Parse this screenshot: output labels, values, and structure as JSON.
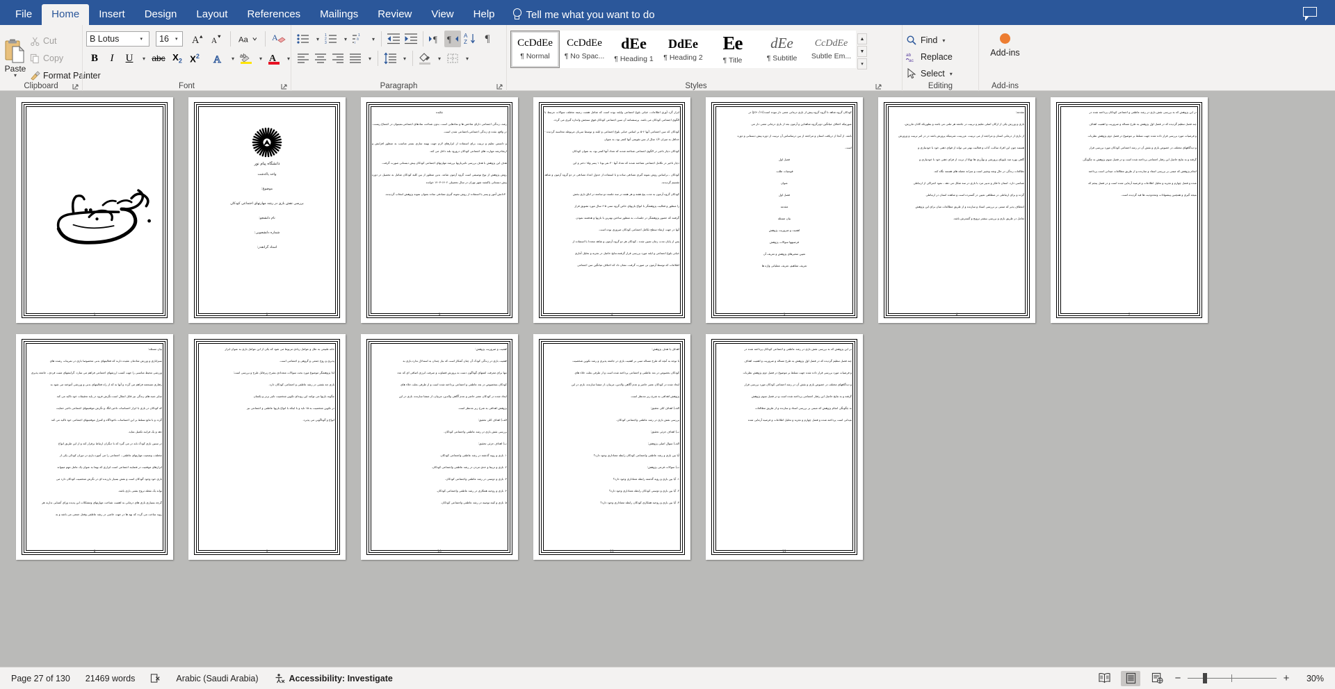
{
  "app": {
    "comment_icon": "comment-icon"
  },
  "tabs": [
    {
      "label": "File",
      "active": false
    },
    {
      "label": "Home",
      "active": true
    },
    {
      "label": "Insert",
      "active": false
    },
    {
      "label": "Design",
      "active": false
    },
    {
      "label": "Layout",
      "active": false
    },
    {
      "label": "References",
      "active": false
    },
    {
      "label": "Mailings",
      "active": false
    },
    {
      "label": "Review",
      "active": false
    },
    {
      "label": "View",
      "active": false
    },
    {
      "label": "Help",
      "active": false
    }
  ],
  "tellme": {
    "label": "Tell me what you want to do",
    "icon": "lightbulb-icon"
  },
  "ribbon": {
    "clipboard": {
      "group_label": "Clipboard",
      "paste": "Paste",
      "cut": "Cut",
      "copy": "Copy",
      "format_painter": "Format Painter"
    },
    "font": {
      "group_label": "Font",
      "font_name": "B Lotus",
      "font_size": "16",
      "grow_font": "Increase Font Size",
      "shrink_font": "Decrease Font Size",
      "change_case": "Aa",
      "clear_formatting": "Clear All Formatting",
      "bold": "B",
      "italic": "I",
      "underline": "U",
      "strikethrough": "abc",
      "subscript": "X2",
      "superscript": "X2",
      "text_effects": "A",
      "highlight": "ab",
      "font_color": "A"
    },
    "paragraph": {
      "group_label": "Paragraph",
      "bullets": "Bullets",
      "numbering": "Numbering",
      "multilevel": "Multilevel List",
      "decrease_indent": "Decrease Indent",
      "increase_indent": "Increase Indent",
      "ltr": "Left-to-Right Text Direction",
      "rtl": "Right-to-Left Text Direction",
      "sort": "Sort",
      "show_marks": "Show/Hide ¶",
      "align_left": "Align Left",
      "align_center": "Center",
      "align_right": "Align Right",
      "justify": "Justify",
      "line_spacing": "Line and Paragraph Spacing",
      "shading": "Shading",
      "borders": "Borders"
    },
    "styles": {
      "group_label": "Styles",
      "items": [
        {
          "preview": "CcDdEe",
          "name": "¶ Normal",
          "style": "normal",
          "active": true
        },
        {
          "preview": "CcDdEe",
          "name": "¶ No Spac...",
          "style": "nospace",
          "active": false
        },
        {
          "preview": "dEe",
          "name": "¶ Heading 1",
          "style": "h1",
          "active": false
        },
        {
          "preview": "DdEe",
          "name": "¶ Heading 2",
          "style": "h2",
          "active": false
        },
        {
          "preview": "Ee",
          "name": "¶ Title",
          "style": "title",
          "active": false
        },
        {
          "preview": "dEe",
          "name": "¶ Subtitle",
          "style": "subtitle",
          "active": false
        },
        {
          "preview": "CcDdEe",
          "name": "Subtle Em...",
          "style": "subtle",
          "active": false
        }
      ]
    },
    "editing": {
      "group_label": "Editing",
      "find": "Find",
      "replace": "Replace",
      "select": "Select"
    },
    "addins": {
      "group_label": "Add-ins",
      "label": "Add-ins"
    }
  },
  "status": {
    "page": "Page 27 of 130",
    "words": "21469 words",
    "proofing_icon": "proofing-errors-icon",
    "language": "Arabic (Saudi Arabia)",
    "accessibility": "Accessibility: Investigate",
    "view_read": "Read Mode",
    "view_print": "Print Layout",
    "view_web": "Web Layout",
    "zoom_out": "−",
    "zoom_in": "+",
    "zoom_level": "30%"
  },
  "document": {
    "pages": [
      {
        "num": "1",
        "kind": "bismillah",
        "lines": []
      },
      {
        "num": "2",
        "kind": "title",
        "logo_caption": "دانشگاه پیام نور",
        "lines": [
          {
            "t": "واحد پاکدشت",
            "a": "c"
          },
          {
            "t": "موضوع:",
            "a": "c"
          },
          {
            "t": "بررسی نقش بازی در رشد مهارتهای اجتماعی کودکان",
            "a": "c"
          },
          {
            "t": "نام دانشجو:",
            "a": "c"
          },
          {
            "t": "شماره دانشجویی:",
            "a": "c"
          },
          {
            "t": "استاد گرانقدر:",
            "a": "c"
          }
        ]
      },
      {
        "num": "3",
        "kind": "text",
        "lines": [
          {
            "t": "چکیده",
            "a": "c"
          },
          {
            "t": "رشد، زندگی اجتماعی دارای شاخص ها و نمادهایی است. بدون شناخت نمادهای اجتماعی،نمیتوان در اجتماع زیست. در واقع، نقده ی زندگی اجتماعی،اجتماعی شدن است.",
            "a": "j"
          },
          {
            "t": "و دانستن تعلیم و تربیت برای استفاده از ابزارهای لازم جهت بهینه سازی بستر مناسب به منظور افزایش و ارتقاءرشد مهارت های اجتماعی کودکان درورود بلند داخل می کند.",
            "a": "j"
          },
          {
            "t": "هدف این پژوهش با هدف بررسی تاثیربازیها بررشد مهارتهای اجتماعی کودکان پیش دبستانی صورت گرفت.",
            "a": "j"
          },
          {
            "t": "روش پژوهش از نوع توصیفی است گروه آزمون شامد. بدین منظور از بین کلیه کودکان شامل به تحصیل در دوره پیش دبستانی یاکشند شهر تهران در سال تحصیلی ۱۴۰۲-۱۴۰۳ خوانده",
            "a": "j"
          },
          {
            "t": "۳۰دانش آموز و پسر با استفاده از روش نمونه گیری تصادفی ساده بعنوان نمونه پژوهش انتخاب گردیدند.",
            "a": "j"
          }
        ]
      },
      {
        "num": "4",
        "kind": "text",
        "lines": [
          {
            "t": "ابزار گرد آوری اطلاعات، خیانی بلوغ اجتماعی وایلند بوده است که شامل هشت زمینه مختلف سوالات مرتبط با الگوی اجتماعی کودکان می باشد. پرسشنامه آن سین اجتماعی کودکان فوق سنجش واندازه گیری می گردد.",
            "a": "j"
          },
          {
            "t": "کودکان که سن اجتماعی آنها ۶-۵ بر اساس خیانی بلوغ اجتماعی و ایلند و توسط سریان مربوطه محاسبه گردیده - حداقل به میزان ۱/۲ سال از سن تقویمی آنها کمتر بود، به عنوان",
            "a": "j"
          },
          {
            "t": "کودکان دچار تاخیر در الگوی اجتماعی شناخته شدند که تعداد آنها کمتر بود، به عنوان کودکان",
            "a": "j"
          },
          {
            "t": "دچار تاخیر در تکامل اجتماعی شناخته شدند که تعداد آنها ۳۰ نفر بودا ۱ پسر و۱۵ دختر و این",
            "a": "j"
          },
          {
            "t": "کودکان ، براساس روش نمونه گیری تصادفی ساده و با استفاده از جدول اعداد تصادفی در دو گروه آزمون و شاهد تقسیم گردیدند.",
            "a": "j"
          },
          {
            "t": "کودکان گروه آزمون به مدت پنج هفته و هر هفته در سه جلسه دو ساعته در اتاق بازی بخش",
            "a": "j"
          },
          {
            "t": "را منظور و فعالیت پژوهشگر با انواع بازیهای خاص گروه سنی ۵-۶ سال مورد تشویق قرار",
            "a": "j"
          },
          {
            "t": "گرفتند که حضور پژوهشگر در جلسات، به منظور ساختن بهترین با بازیها و هدفمند نمودن",
            "a": "j"
          },
          {
            "t": "آنها در جهت ارتقاء سطح تکامل اجتماعی کودکان ضروری بوده است.",
            "a": "j"
          },
          {
            "t": "پس از پایان مدت زمان تعیین شده ، کودکان هر دو گروه آزمون و شاهد مجددا با استفاده از",
            "a": "j"
          },
          {
            "t": "خیانی بلوغ اجتماعی و ایلند مورد بررسی قرار گرفتند،نتایج حاصل در تجزیه و تحلیل آماری",
            "a": "j"
          },
          {
            "t": "اطلاعات که توسط آزمون تی صورت گرفت، نشان داد که اختلاف میانگین سن اجتماعی",
            "a": "j"
          }
        ]
      },
      {
        "num": "5",
        "kind": "text",
        "lines": [
          {
            "t": "کودکان گروه شاهد تا گروه   گروه پیش از بازی درمانی معنی دار نبوده است(۰/۱۷<p) در",
            "a": "j"
          },
          {
            "t": "صورتیکه اختلاف میانگین دوبرگروه شاهداین و آزمون بعد از بازی درمانی معنی دار می",
            "a": "j"
          },
          {
            "t": "باشد. از آنجا از دریافت استان و مراجعه از بین درساساس آن تربیت از دوره پیش دبستانی و دوره",
            "a": "j"
          },
          {
            "t": "است.",
            "a": "j"
          },
          {
            "t": "فصل اول",
            "a": "c"
          },
          {
            "t": "قوسیات طلب.",
            "a": "c"
          },
          {
            "t": "عنوان",
            "a": "c"
          },
          {
            "t": "فصل اول",
            "a": "c"
          },
          {
            "t": "مقدمه",
            "a": "c"
          },
          {
            "t": "بیان مسئله",
            "a": "c"
          },
          {
            "t": "اهمیت و ضروریت پژوهش",
            "a": "c"
          },
          {
            "t": "فرضیهها سوالات پژوهش",
            "a": "c"
          },
          {
            "t": "تعیین متغیرهای پژوهش و تعریف آن",
            "a": "c"
          },
          {
            "t": "تعریف مفاهیم، تعریف عملیاتی واژه ها",
            "a": "c"
          }
        ]
      },
      {
        "num": "6",
        "kind": "text",
        "lines": [
          {
            "t": "مقدمه:",
            "a": "r"
          },
          {
            "t": "بازی و ورزش یکی از ارکان اصلی تعلیم و تربیت در جامعه هر ملتی می باشد و بطوریکه کانان مارزش،",
            "a": "j"
          },
          {
            "t": "از بازی از درمانی استان و مراجعه از می تربیت، عزربیت، شربتیکه پرورش باشد در در امر تربیت و ورورش",
            "a": "j"
          },
          {
            "t": "هستند چون این افراد سالب، آداب و فعالیت بهتر می تواند از قوای ذهنی خود با خودنیازی و",
            "a": "j"
          },
          {
            "t": "گاهی بهره مند باپویای پرورشی و بهآرزی ها تهانا از تربت از فرای ذهنی خود با خودنیازی و",
            "a": "j"
          },
          {
            "t": "نطالعات زندگی در حال وشد وتغییر است و سرانه عضله های هستند نگاه کند.",
            "a": "j"
          },
          {
            "t": "شناسی دارد. استان تا فکر و تدبیر مرد با بازی در سه شکل می دهد ، نمود اجتراکی از ارتباطی",
            "a": "j"
          },
          {
            "t": "گرده و برای ارتباطی در منظاهی تعیین در گسترده است و شاهده استان در ارتباطی",
            "a": "j"
          },
          {
            "t": "انعطاف پذیر که مبتنی بر بررسی استاد و سازنده و از طریق مطالعات میان برای این پژوهش",
            "a": "j"
          },
          {
            "t": "تعامل در طریق بازی و بررسی بیشتر ترویج و گسترش باشد.",
            "a": "j"
          }
        ]
      },
      {
        "num": "7",
        "kind": "text",
        "lines": [
          {
            "t": "در این پژوهش که به بررسی نقش بازی در رشد عاطفی و اجتماعی کودکان پرداخته شده در",
            "a": "j"
          },
          {
            "t": "چند فصل تنظیم گردیده که در فصل اول پژوهش به طرح مساله و ضروریت و اهمیت اهداف",
            "a": "j"
          },
          {
            "t": "و فرضیات مورد بررسی قرار داده شده جهت تسلط بر موضوع در فصل دوم پژوهش نظریات",
            "a": "j"
          },
          {
            "t": "و دیدگاههای مختلف در خصوص بازی و نقش آن در رشد اجتماعی کودکان مورد بررسی قرار",
            "a": "j"
          },
          {
            "t": "گرفته و به نتایج حاصل این رفتار اجتماعی پرداخته شده است و در فصل سوم پژوهش به چگونگی",
            "a": "j"
          },
          {
            "t": "انجام پژوهش که مبتنی بر بررسی استاد و سازنده و از طریق مطالعات میدانی است پرداخته",
            "a": "j"
          },
          {
            "t": "شده و فصل چهارم و تجزیه و تحلیل اطلاعات و فرضیه آزمایی شده است و در فصل پنجم که",
            "a": "j"
          },
          {
            "t": "نتیجه گیری و همچنین پیشنهادات ومحدودیت ها قید گردیده است.",
            "a": "j"
          }
        ]
      },
      {
        "num": "8",
        "kind": "text",
        "lines": [
          {
            "t": "بیان مسئله:",
            "a": "r"
          },
          {
            "t": "سبزابازی و ورزش شادمان عقیده دارند که فعالیتهای بدنی مخصوصا بازی در تمرینات رشده های",
            "a": "j"
          },
          {
            "t": "ورزشی محیط مناسبی را جهت کسب ارزشهای اجتماعی فراهم می سازد. گرایشهای مثبت فردی ، جامعه پذیری",
            "a": "j"
          },
          {
            "t": "رفتاری مسجمه فراهم می گردد و آنها به که از راه فعالیتهای بدنی و ورزشی آموخته می شود به",
            "a": "j"
          },
          {
            "t": "سایر جنبه های زندگی نیز قابل انتقال است.نگرش فرود در پایه تحقیقات خود تاکید می کند",
            "a": "j"
          },
          {
            "t": "که کودکان در بازی با ابزار احساسات تاخیر،انگا، و نگرش موقعیتهای اجتماعی تاخیر حمایت",
            "a": "j"
          },
          {
            "t": "گردد و با مانع تسلط بر این احساسات ناخوداگاه و کنترل موقعیتهای اجتماعی خود تاکید می کند",
            "a": "j"
          },
          {
            "t": "دهد و یک فرایند تکمیل نماید.",
            "a": "j"
          },
          {
            "t": "در سنین بازی کودک باید در می گیرد که با دیگران ارتباط برقرار کند و از این طریق انواع",
            "a": "j"
          },
          {
            "t": "مختلف، وضعیت مهارتهای عاطفی ، اجتماعی را می آموزد.بازی در دوران کودکی یکی از",
            "a": "j"
          },
          {
            "t": "ابزارهای موقعیت در فضایند اجتماعی است.ابزاری که بهما به عنوان یک عامل مهم میتواند",
            "a": "j"
          },
          {
            "t": "بازی خود وجود گودکان است و نقش بسیار بارزنده ای در نگرش شخصیت کودکان دارد می",
            "a": "j"
          },
          {
            "t": "تواند یک نقطه تروج بشتی بازی باشد.",
            "a": "j"
          },
          {
            "t": "گرچه بسیاری بازی های درمانی به اهمیت شناخت مهارتهای ومشکلات این پدیده ورای آشنایی ندارند هر",
            "a": "j"
          },
          {
            "t": "روید ساخت می گردد که بهه ها در جهت خاصی در رشد عاطفی وفعل جمعی می باشد و به",
            "a": "j"
          }
        ]
      },
      {
        "num": "9",
        "kind": "text",
        "lines": [
          {
            "t": "خانه طبیعی به علل و عوامل زیادی مربوط می شود که یکی از این عوامل بازی به عنوان ابزار",
            "a": "j"
          },
          {
            "t": "پذیری و روج جمعی و گروهی و اجتماعی است.",
            "a": "j"
          },
          {
            "t": "لذا پژوهشگر موضوع مورد بحث سوالات متعدادی بشرح زیرقابل طرح و بررسی است:",
            "a": "j"
          },
          {
            "t": "بازی چه نقشی در رشد عاطفی و اجتماعی کودکان دارد.",
            "a": "r"
          },
          {
            "t": "چگونه بازیها می توانند این روندای تکوین شخصیت تاثیر برتر و یکسان",
            "a": "r"
          },
          {
            "t": "در تکوین شخصیت به ۱۵ ناید و با اینکه با انواع بازیها عاطفی و اجتماعی نیز",
            "a": "r"
          },
          {
            "t": "انواع و گوناگونی می پذیرد.",
            "a": "r"
          }
        ]
      },
      {
        "num": "10",
        "kind": "text",
        "lines": [
          {
            "t": "اهمیت و ضروریت پژوهش:",
            "a": "r"
          },
          {
            "t": "اهمیت بازی در زندگی کودک آن چنان آشکار است که نیاز چندان به استدلال ندارد.بازی به",
            "a": "j"
          },
          {
            "t": "تنها برای معرفت اشتهای گوناگون دست به پرورش قضاوت و صرفت انرژی اضافی ای که عدد",
            "a": "j"
          },
          {
            "t": "کودکان بمخصوص در بعد عاطفی و اجتماعی پرداخته شده است و از طرفی بعلت خلاء های",
            "a": "j"
          },
          {
            "t": "ایجاد شده در کودکان عصر حاضر و عدم آگاهی والدین، مربیان، از منشا سازنده، بازی در این",
            "a": "j"
          },
          {
            "t": "پژوهش اهدافی به شرح زیر مدنظر است.",
            "a": "j"
          },
          {
            "t": "الف) اهداف کلی تحقیق:",
            "a": "r"
          },
          {
            "t": "بررسی نقش بازی در رشد عاطفی واجتماعی کودکان.",
            "a": "r"
          },
          {
            "t": "ب) اهداف جزئی تحقیق:",
            "a": "r"
          },
          {
            "t": "۱. بازی و رویه گذشته در رشد عاطفی واجتماعی کودکان.",
            "a": "r"
          },
          {
            "t": "۲. بازی و تربیتا و حدی مردن در رشد عاطفی واجتماعی کودکان.",
            "a": "r"
          },
          {
            "t": "۳. بازی و دوستی در رشد عاطفی واجتماعی کودکان.",
            "a": "r"
          },
          {
            "t": "۴. بازی و روحیه همکاری در رشد عاطفی واجتماعی کودکان.",
            "a": "r"
          },
          {
            "t": "۵. بازی و کینه توصیه در رشد عاطفی واجتماعی کودکان.",
            "a": "r"
          }
        ]
      },
      {
        "num": "11",
        "kind": "text",
        "lines": [
          {
            "t": "اهداف یا هدف پژوهش:",
            "a": "r"
          },
          {
            "t": "با توجه به آنچه که طرح مساله مبنی بر اهمیت بازی در جامعه پذیری و رشد تکوین شخصیت",
            "a": "j"
          },
          {
            "t": "کودکان بخصوص در بعد عاطفی و اجتماعی پرداخته شده است و از طرفی بعلت خلاء های",
            "a": "j"
          },
          {
            "t": "ایجاد شده در کودکان عصر حاضر و عدم آگاهی والدین، مربیان، از منشا سازنده، بازی در این",
            "a": "j"
          },
          {
            "t": "پژوهش اهدافی به شرح زیر مدنظر است.",
            "a": "j"
          },
          {
            "t": "الف) اهداف کلی تحقیق:",
            "a": "r"
          },
          {
            "t": "بررسی نقش بازی در رشد عاطفی واجتماعی کودکان.",
            "a": "r"
          },
          {
            "t": "ب) اهداف جزئی تحقیق:",
            "a": "r"
          },
          {
            "t": "الف) سوال اصلی پژوهش:",
            "a": "r"
          },
          {
            "t": "آیا بین بازی و رشد عاطفی واجتماعی کودکان رابطه معناداری وجود دارد؟",
            "a": "r"
          },
          {
            "t": "ب) سوالات فرعی پژوهش:",
            "a": "r"
          },
          {
            "t": "۱. آیا بین بازی و رویه گذشته رابطه معناداری وجود دارد؟",
            "a": "r"
          },
          {
            "t": "۲. آیا بین بازی و دوستی کودکان رابطه معناداری وجود دارد؟",
            "a": "r"
          },
          {
            "t": "۳. آیا بین بازی و روحیه همکاری کودکان رابطه معناداری وجود دارد؟",
            "a": "r"
          }
        ]
      },
      {
        "num": "12",
        "kind": "text",
        "lines": [
          {
            "t": "در این پژوهش که به بررسی نقش بازی در رشد عاطفی و اجتماعی کودکان پرداخته شده در",
            "a": "j"
          },
          {
            "t": "چند فصل تنظیم گردیده که در فصل اول پژوهش به طرح مساله و ضروریت و اهمیت اهداف",
            "a": "j"
          },
          {
            "t": "و فرضیات مورد بررسی قرار داده شده جهت تسلط بر موضوع در فصل دوم پژوهش نظریات",
            "a": "j"
          },
          {
            "t": "و دیدگاههای مختلف در خصوص بازی و نقش آن در رشد اجتماعی کودکان مورد بررسی قرار",
            "a": "j"
          },
          {
            "t": "گرفته و به نتایج حاصل این رفتار اجتماعی پرداخته شده است و در فصل سوم پژوهش",
            "a": "j"
          },
          {
            "t": "به چگونگی انجام پژوهش که مبتنی بر بررسی استاد و سازنده و از طریق مطالعات",
            "a": "j"
          },
          {
            "t": "میدانی است پرداخته شده و فصل چهارم و تجزیه و تحلیل اطلاعات و فرضیه آزمایی شده",
            "a": "j"
          }
        ]
      }
    ]
  }
}
